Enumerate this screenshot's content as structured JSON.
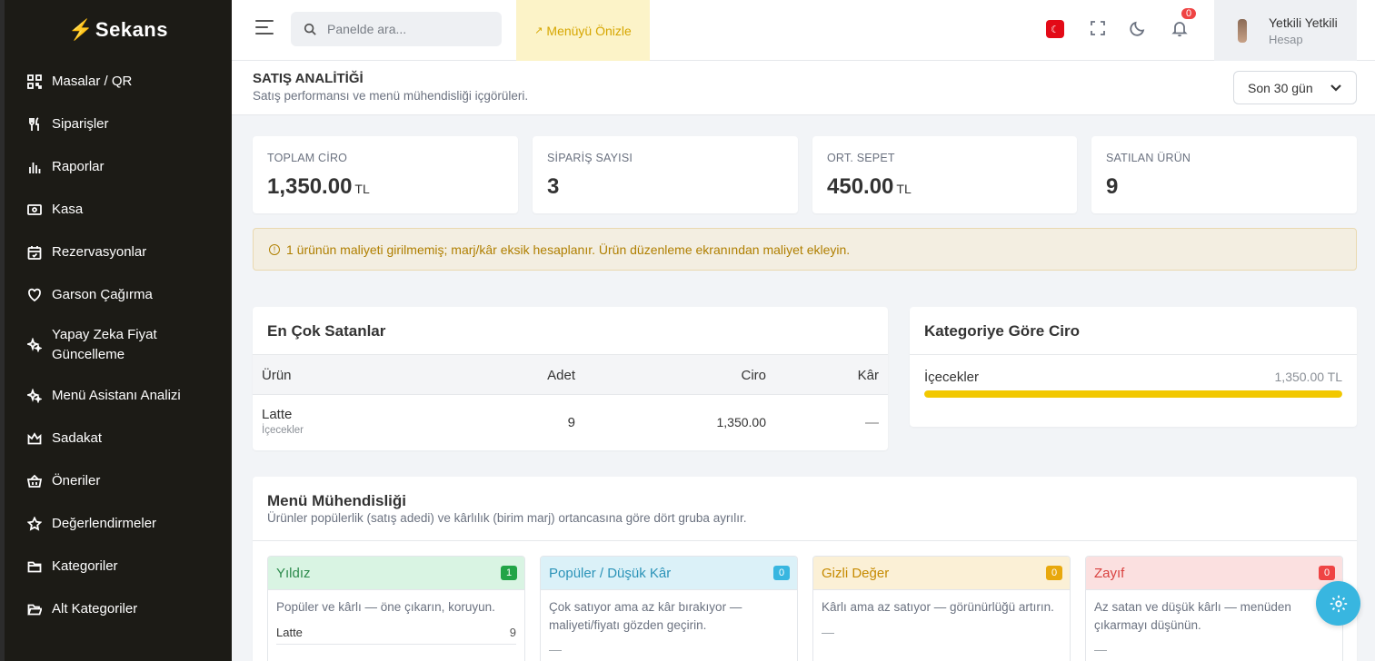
{
  "brand": {
    "logo_text": "Sekans"
  },
  "sidebar": {
    "items": [
      {
        "label": "Masalar / QR",
        "icon": "qr-icon"
      },
      {
        "label": "Siparişler",
        "icon": "utensils-icon"
      },
      {
        "label": "Raporlar",
        "icon": "bar-chart-icon"
      },
      {
        "label": "Kasa",
        "icon": "cash-icon"
      },
      {
        "label": "Rezervasyonlar",
        "icon": "calendar-icon"
      },
      {
        "label": "Garson Çağırma",
        "icon": "heart-hand-icon"
      },
      {
        "label": "Yapay Zeka Fiyat Güncelleme",
        "icon": "sparkles-icon"
      },
      {
        "label": "Menü Asistanı Analizi",
        "icon": "sparkles-icon"
      },
      {
        "label": "Sadakat",
        "icon": "crown-icon"
      },
      {
        "label": "Öneriler",
        "icon": "basket-icon"
      },
      {
        "label": "Değerlendirmeler",
        "icon": "star-icon"
      },
      {
        "label": "Kategoriler",
        "icon": "folder-icon"
      },
      {
        "label": "Alt Kategoriler",
        "icon": "folder-open-icon"
      }
    ]
  },
  "topbar": {
    "search_placeholder": "Panelde ara...",
    "preview_label": "Menüyü Önizle",
    "notification_count": "0",
    "user_name": "Yetkili Yetkili",
    "user_sub": "Hesap"
  },
  "header": {
    "title": "SATIŞ ANALİTİĞİ",
    "subtitle": "Satış performansı ve menü mühendisliği içgörüleri.",
    "period": "Son 30 gün"
  },
  "stats": [
    {
      "label": "TOPLAM CİRO",
      "value": "1,350.00",
      "unit": "TL"
    },
    {
      "label": "SİPARİŞ SAYISI",
      "value": "3",
      "unit": ""
    },
    {
      "label": "ORT. SEPET",
      "value": "450.00",
      "unit": "TL"
    },
    {
      "label": "SATILAN ÜRÜN",
      "value": "9",
      "unit": ""
    }
  ],
  "warning": "1 ürünün maliyeti girilmemiş; marj/kâr eksik hesaplanır. Ürün düzenleme ekranından maliyet ekleyin.",
  "top_sellers": {
    "title": "En Çok Satanlar",
    "columns": [
      "Ürün",
      "Adet",
      "Ciro",
      "Kâr"
    ],
    "rows": [
      {
        "name": "Latte",
        "category": "İçecekler",
        "qty": "9",
        "revenue": "1,350.00",
        "profit": "—"
      }
    ]
  },
  "category_revenue": {
    "title": "Kategoriye Göre Ciro",
    "items": [
      {
        "name": "İçecekler",
        "value": "1,350.00 TL",
        "share": 1.0
      }
    ]
  },
  "menu_engineering": {
    "title": "Menü Mühendisliği",
    "subtitle": "Ürünler popülerlik (satış adedi) ve kârlılık (birim marj) ortancasına göre dört gruba ayrılır.",
    "quadrants": [
      {
        "title": "Yıldız",
        "count": "1",
        "desc": "Popüler ve kârlı — öne çıkarın, koruyun.",
        "items": [
          {
            "name": "Latte",
            "qty": "9"
          }
        ],
        "empty": "",
        "head_bg": "#d9f4e3",
        "head_color": "#2b8a4b",
        "badge_color": "#22a447"
      },
      {
        "title": "Popüler / Düşük Kâr",
        "count": "0",
        "desc": "Çok satıyor ama az kâr bırakıyor — maliyeti/fiyatı gözden geçirin.",
        "items": [],
        "empty": "—",
        "head_bg": "#dbf1f8",
        "head_color": "#2b93b8",
        "badge_color": "#38b6e0"
      },
      {
        "title": "Gizli Değer",
        "count": "0",
        "desc": "Kârlı ama az satıyor — görünürlüğü artırın.",
        "items": [],
        "empty": "—",
        "head_bg": "#fbf0d6",
        "head_color": "#c68a00",
        "badge_color": "#e8a80c"
      },
      {
        "title": "Zayıf",
        "count": "0",
        "desc": "Az satan ve düşük kârlı — menüden çıkarmayı düşünün.",
        "items": [],
        "empty": "—",
        "head_bg": "#fbe0e0",
        "head_color": "#d9413f",
        "badge_color": "#ef4444"
      }
    ]
  }
}
